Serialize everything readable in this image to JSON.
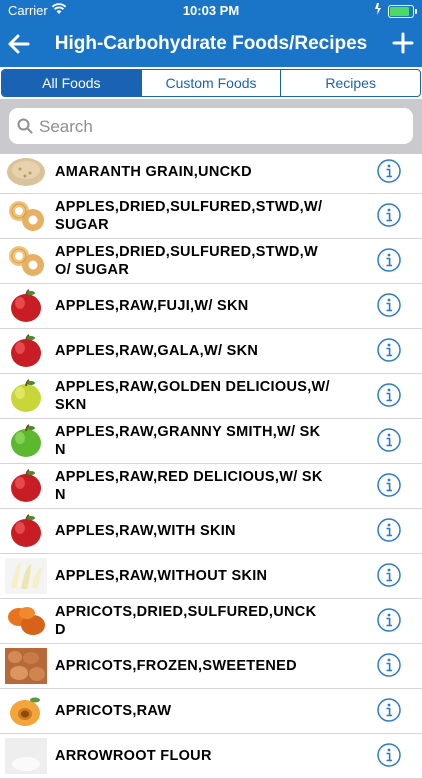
{
  "status": {
    "carrier": "Carrier",
    "time": "10:03 PM"
  },
  "nav": {
    "title": "High-Carbohydrate Foods/Recipes"
  },
  "tabs": [
    "All Foods",
    "Custom Foods",
    "Recipes"
  ],
  "search": {
    "placeholder": "Search"
  },
  "foods": [
    {
      "name": "AMARANTH GRAIN,UNCKD",
      "thumb": "grain-icon"
    },
    {
      "name": "APPLES,DRIED,SULFURED,STWD,W/ SUGAR",
      "thumb": "dried-apple-icon"
    },
    {
      "name": "APPLES,DRIED,SULFURED,STWD,W O/ SUGAR",
      "thumb": "dried-apple-icon"
    },
    {
      "name": "APPLES,RAW,FUJI,W/ SKN",
      "thumb": "red-apple-icon"
    },
    {
      "name": "APPLES,RAW,GALA,W/ SKN",
      "thumb": "red-apple-icon"
    },
    {
      "name": "APPLES,RAW,GOLDEN DELICIOUS,W/ SKN",
      "thumb": "yellow-apple-icon"
    },
    {
      "name": "APPLES,RAW,GRANNY SMITH,W/ SKN",
      "thumb": "green-apple-icon"
    },
    {
      "name": "APPLES,RAW,RED DELICIOUS,W/ SKN",
      "thumb": "red-apple-icon"
    },
    {
      "name": "APPLES,RAW,WITH SKIN",
      "thumb": "red-apple-icon"
    },
    {
      "name": "APPLES,RAW,WITHOUT SKIN",
      "thumb": "apple-slices-icon"
    },
    {
      "name": "APRICOTS,DRIED,SULFURED,UNCK D",
      "thumb": "dried-apricot-icon"
    },
    {
      "name": "APRICOTS,FROZEN,SWEETENED",
      "thumb": "frozen-apricot-icon"
    },
    {
      "name": "APRICOTS,RAW",
      "thumb": "apricot-icon"
    },
    {
      "name": "ARROWROOT FLOUR",
      "thumb": "flour-icon"
    }
  ],
  "colors": {
    "brand": "#1a75c9",
    "segment": "#1a63b4",
    "info": "#2a7bd0"
  }
}
